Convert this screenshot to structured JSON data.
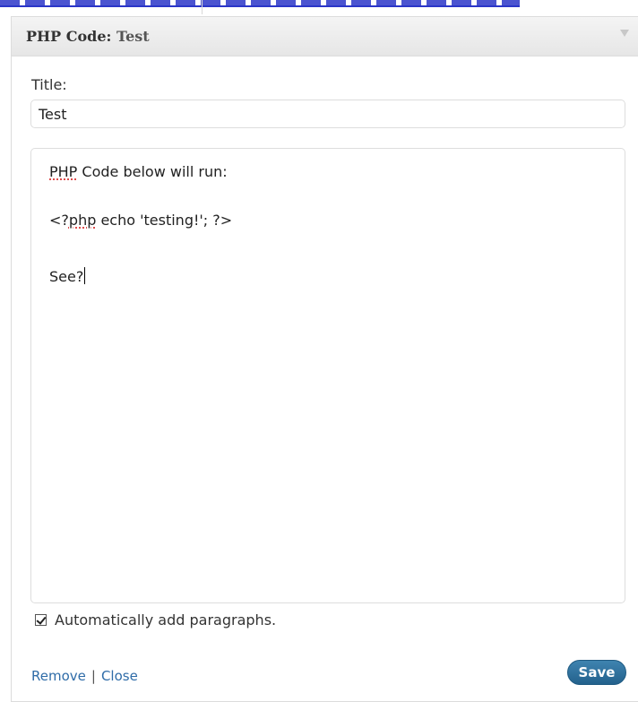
{
  "widget": {
    "title_type": "PHP Code",
    "title_separator": ":",
    "title_name": "Test"
  },
  "form": {
    "title_label": "Title:",
    "title_value": "Test",
    "code_lines": [
      "PHP Code below will run:",
      "<?php echo 'testing!'; ?>",
      "See?"
    ],
    "auto_paragraphs_label": "Automatically add paragraphs.",
    "auto_paragraphs_checked": true
  },
  "footer": {
    "remove_label": "Remove",
    "separator": "|",
    "close_label": "Close",
    "save_label": "Save"
  },
  "colors": {
    "link": "#2f6ca8",
    "save_button": "#23618c"
  }
}
